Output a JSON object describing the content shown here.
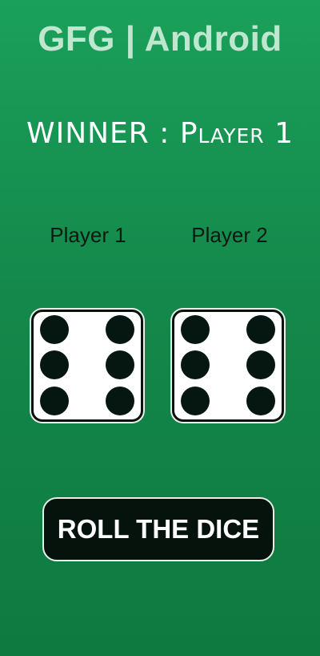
{
  "app": {
    "title": "GFG | Android"
  },
  "result": {
    "winner_text": "WINNER : Player 1"
  },
  "players": [
    {
      "label": "Player 1",
      "die_value": 6
    },
    {
      "label": "Player 2",
      "die_value": 6
    }
  ],
  "actions": {
    "roll_label": "ROLL THE DICE"
  },
  "colors": {
    "background": "#14884a",
    "title_text": "#bfe6cf",
    "pip": "#061611",
    "button_bg": "#06130d"
  }
}
